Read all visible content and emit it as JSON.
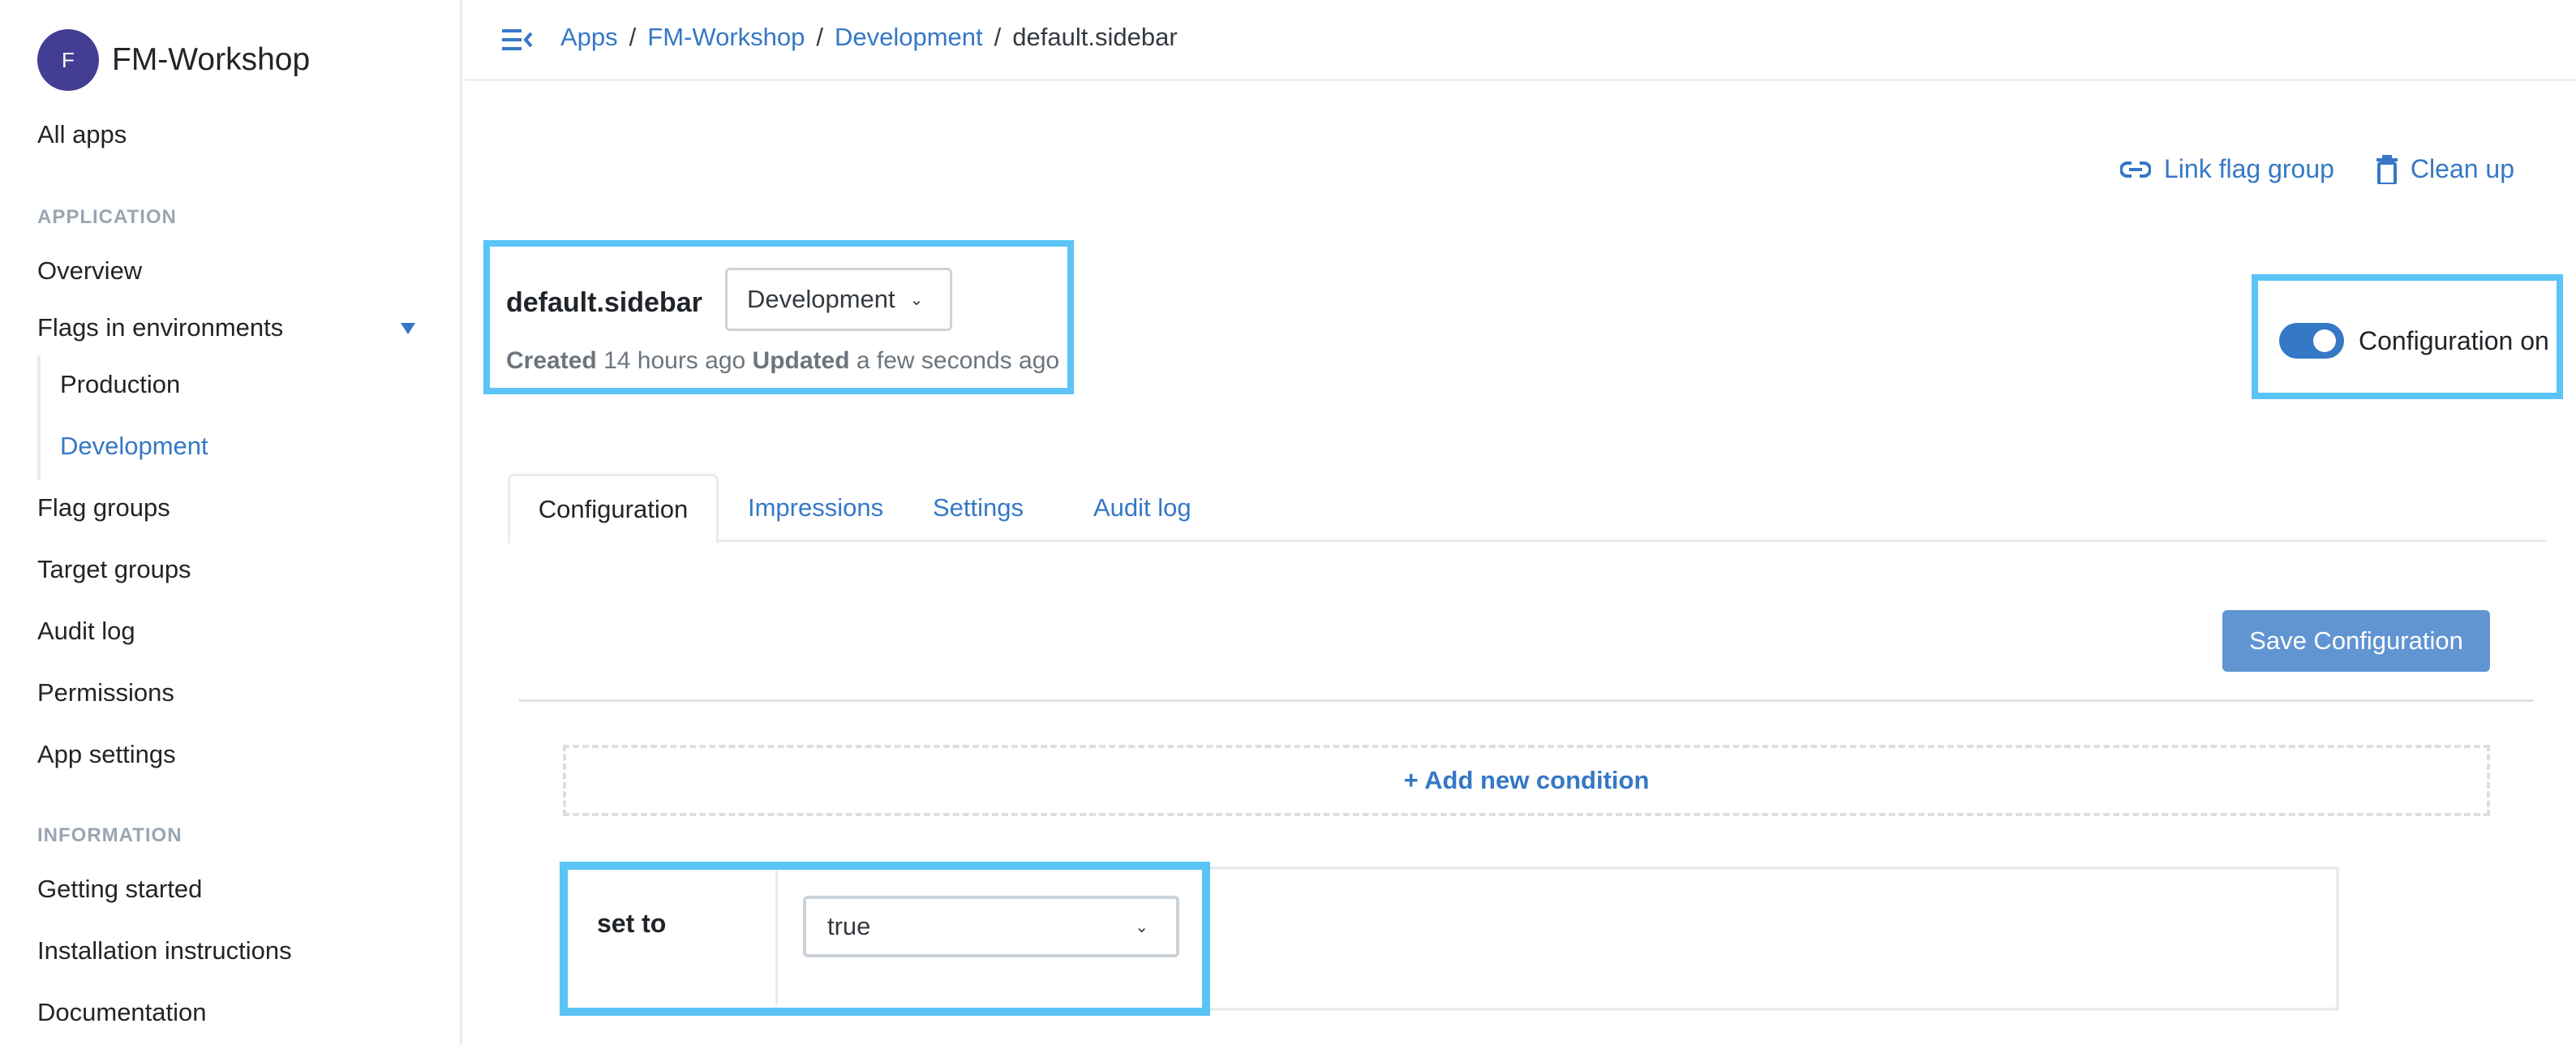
{
  "sidebar": {
    "brand": {
      "initial": "F",
      "name": "FM-Workshop",
      "avatar_color": "#433e94"
    },
    "all_apps": "All apps",
    "application_heading": "APPLICATION",
    "items": [
      {
        "label": "Overview"
      },
      {
        "label": "Flags in environments",
        "expanded": true
      },
      {
        "label": "Flag groups"
      },
      {
        "label": "Target groups"
      },
      {
        "label": "Audit log"
      },
      {
        "label": "Permissions"
      },
      {
        "label": "App settings"
      }
    ],
    "environments": [
      {
        "label": "Production",
        "active": false
      },
      {
        "label": "Development",
        "active": true
      }
    ],
    "information_heading": "INFORMATION",
    "info_items": [
      {
        "label": "Getting started"
      },
      {
        "label": "Installation instructions"
      },
      {
        "label": "Documentation"
      }
    ]
  },
  "breadcrumb": {
    "items": [
      "Apps",
      "FM-Workshop",
      "Development"
    ],
    "separator": "/",
    "current": "default.sidebar"
  },
  "actions": {
    "link_flag_group": "Link flag group",
    "clean_up": "Clean up"
  },
  "flag": {
    "name": "default.sidebar",
    "environment": "Development",
    "created_label": "Created",
    "created_value": "14 hours ago",
    "updated_label": "Updated",
    "updated_value": "a few seconds ago"
  },
  "toggle": {
    "label": "Configuration on",
    "on": true
  },
  "tabs": [
    {
      "label": "Configuration",
      "active": true
    },
    {
      "label": "Impressions"
    },
    {
      "label": "Settings"
    },
    {
      "label": "Audit log"
    }
  ],
  "save_button": "Save Configuration",
  "add_condition": "+ Add new condition",
  "condition": {
    "label": "set to",
    "value": "true"
  },
  "colors": {
    "accent": "#3578c6",
    "highlight": "#5bc4f7",
    "save": "#6195d2"
  }
}
